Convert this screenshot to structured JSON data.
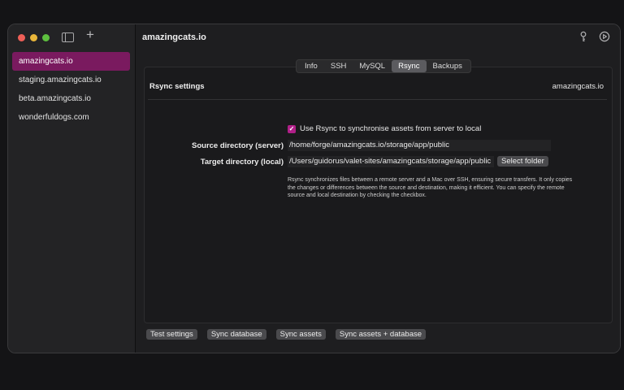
{
  "sidebar": {
    "sites": [
      {
        "label": "amazingcats.io",
        "active": true
      },
      {
        "label": "staging.amazingcats.io",
        "active": false
      },
      {
        "label": "beta.amazingcats.io",
        "active": false
      },
      {
        "label": "wonderfuldogs.com",
        "active": false
      }
    ],
    "add_icon": "plus-icon",
    "toggle_icon": "sidebar-toggle-icon"
  },
  "toolbar": {
    "title": "amazingcats.io",
    "icons": [
      "key-icon",
      "play-circle-icon"
    ]
  },
  "tabs": [
    {
      "label": "Info",
      "active": false
    },
    {
      "label": "SSH",
      "active": false
    },
    {
      "label": "MySQL",
      "active": false
    },
    {
      "label": "Rsync",
      "active": true
    },
    {
      "label": "Backups",
      "active": false
    }
  ],
  "section": {
    "title": "Rsync settings",
    "site": "amazingcats.io"
  },
  "form": {
    "checkbox_label": "Use Rsync to synchronise assets from server to local",
    "checkbox_checked": true,
    "source_label": "Source directory (server)",
    "source_value": "/home/forge/amazingcats.io/storage/app/public",
    "target_label": "Target directory (local)",
    "target_value": "/Users/guidorus/valet-sites/amazingcats/storage/app/public",
    "select_folder": "Select folder",
    "description": "Rsync synchronizes files between a remote server and a Mac over SSH, ensuring secure transfers. It only copies the changes or differences between the source and destination, making it efficient. You can specify the remote source and local destination by checking the checkbox."
  },
  "actions": {
    "test_settings": "Test settings",
    "sync_database": "Sync database",
    "sync_assets": "Sync assets",
    "sync_assets_database": "Sync assets + database"
  },
  "colors": {
    "accent": "#7a1a5f",
    "checkbox": "#b01f88",
    "window_bg": "#1e1e20",
    "sidebar_bg": "#232325"
  }
}
